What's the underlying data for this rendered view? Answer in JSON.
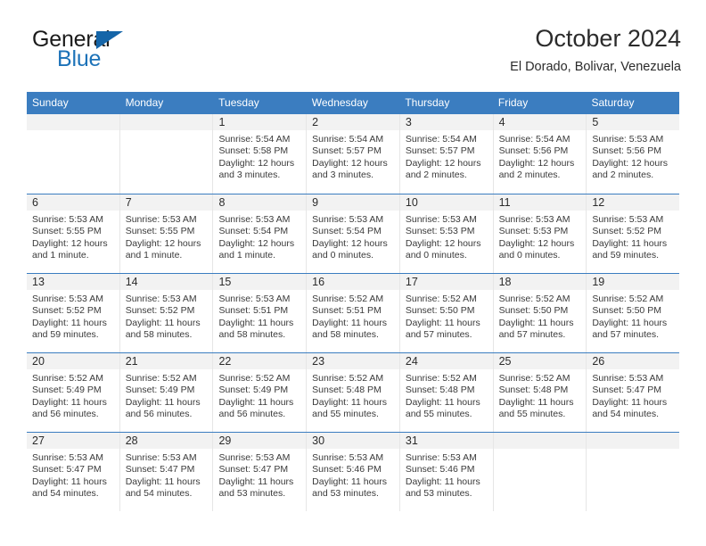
{
  "logo": {
    "word_top": "General",
    "word_bottom": "Blue",
    "accent_color": "#1c72b8"
  },
  "header": {
    "title": "October 2024",
    "subtitle": "El Dorado, Bolivar, Venezuela"
  },
  "theme": {
    "header_blue": "#3b7dc0",
    "day_band_gray": "#f2f2f2",
    "cell_border": "#e6e6e6"
  },
  "weekdays": [
    "Sunday",
    "Monday",
    "Tuesday",
    "Wednesday",
    "Thursday",
    "Friday",
    "Saturday"
  ],
  "weeks": [
    [
      {
        "day": "",
        "sunrise": "",
        "sunset": "",
        "daylight_a": "",
        "daylight_b": ""
      },
      {
        "day": "",
        "sunrise": "",
        "sunset": "",
        "daylight_a": "",
        "daylight_b": ""
      },
      {
        "day": "1",
        "sunrise": "Sunrise: 5:54 AM",
        "sunset": "Sunset: 5:58 PM",
        "daylight_a": "Daylight: 12 hours",
        "daylight_b": "and 3 minutes."
      },
      {
        "day": "2",
        "sunrise": "Sunrise: 5:54 AM",
        "sunset": "Sunset: 5:57 PM",
        "daylight_a": "Daylight: 12 hours",
        "daylight_b": "and 3 minutes."
      },
      {
        "day": "3",
        "sunrise": "Sunrise: 5:54 AM",
        "sunset": "Sunset: 5:57 PM",
        "daylight_a": "Daylight: 12 hours",
        "daylight_b": "and 2 minutes."
      },
      {
        "day": "4",
        "sunrise": "Sunrise: 5:54 AM",
        "sunset": "Sunset: 5:56 PM",
        "daylight_a": "Daylight: 12 hours",
        "daylight_b": "and 2 minutes."
      },
      {
        "day": "5",
        "sunrise": "Sunrise: 5:53 AM",
        "sunset": "Sunset: 5:56 PM",
        "daylight_a": "Daylight: 12 hours",
        "daylight_b": "and 2 minutes."
      }
    ],
    [
      {
        "day": "6",
        "sunrise": "Sunrise: 5:53 AM",
        "sunset": "Sunset: 5:55 PM",
        "daylight_a": "Daylight: 12 hours",
        "daylight_b": "and 1 minute."
      },
      {
        "day": "7",
        "sunrise": "Sunrise: 5:53 AM",
        "sunset": "Sunset: 5:55 PM",
        "daylight_a": "Daylight: 12 hours",
        "daylight_b": "and 1 minute."
      },
      {
        "day": "8",
        "sunrise": "Sunrise: 5:53 AM",
        "sunset": "Sunset: 5:54 PM",
        "daylight_a": "Daylight: 12 hours",
        "daylight_b": "and 1 minute."
      },
      {
        "day": "9",
        "sunrise": "Sunrise: 5:53 AM",
        "sunset": "Sunset: 5:54 PM",
        "daylight_a": "Daylight: 12 hours",
        "daylight_b": "and 0 minutes."
      },
      {
        "day": "10",
        "sunrise": "Sunrise: 5:53 AM",
        "sunset": "Sunset: 5:53 PM",
        "daylight_a": "Daylight: 12 hours",
        "daylight_b": "and 0 minutes."
      },
      {
        "day": "11",
        "sunrise": "Sunrise: 5:53 AM",
        "sunset": "Sunset: 5:53 PM",
        "daylight_a": "Daylight: 12 hours",
        "daylight_b": "and 0 minutes."
      },
      {
        "day": "12",
        "sunrise": "Sunrise: 5:53 AM",
        "sunset": "Sunset: 5:52 PM",
        "daylight_a": "Daylight: 11 hours",
        "daylight_b": "and 59 minutes."
      }
    ],
    [
      {
        "day": "13",
        "sunrise": "Sunrise: 5:53 AM",
        "sunset": "Sunset: 5:52 PM",
        "daylight_a": "Daylight: 11 hours",
        "daylight_b": "and 59 minutes."
      },
      {
        "day": "14",
        "sunrise": "Sunrise: 5:53 AM",
        "sunset": "Sunset: 5:52 PM",
        "daylight_a": "Daylight: 11 hours",
        "daylight_b": "and 58 minutes."
      },
      {
        "day": "15",
        "sunrise": "Sunrise: 5:53 AM",
        "sunset": "Sunset: 5:51 PM",
        "daylight_a": "Daylight: 11 hours",
        "daylight_b": "and 58 minutes."
      },
      {
        "day": "16",
        "sunrise": "Sunrise: 5:52 AM",
        "sunset": "Sunset: 5:51 PM",
        "daylight_a": "Daylight: 11 hours",
        "daylight_b": "and 58 minutes."
      },
      {
        "day": "17",
        "sunrise": "Sunrise: 5:52 AM",
        "sunset": "Sunset: 5:50 PM",
        "daylight_a": "Daylight: 11 hours",
        "daylight_b": "and 57 minutes."
      },
      {
        "day": "18",
        "sunrise": "Sunrise: 5:52 AM",
        "sunset": "Sunset: 5:50 PM",
        "daylight_a": "Daylight: 11 hours",
        "daylight_b": "and 57 minutes."
      },
      {
        "day": "19",
        "sunrise": "Sunrise: 5:52 AM",
        "sunset": "Sunset: 5:50 PM",
        "daylight_a": "Daylight: 11 hours",
        "daylight_b": "and 57 minutes."
      }
    ],
    [
      {
        "day": "20",
        "sunrise": "Sunrise: 5:52 AM",
        "sunset": "Sunset: 5:49 PM",
        "daylight_a": "Daylight: 11 hours",
        "daylight_b": "and 56 minutes."
      },
      {
        "day": "21",
        "sunrise": "Sunrise: 5:52 AM",
        "sunset": "Sunset: 5:49 PM",
        "daylight_a": "Daylight: 11 hours",
        "daylight_b": "and 56 minutes."
      },
      {
        "day": "22",
        "sunrise": "Sunrise: 5:52 AM",
        "sunset": "Sunset: 5:49 PM",
        "daylight_a": "Daylight: 11 hours",
        "daylight_b": "and 56 minutes."
      },
      {
        "day": "23",
        "sunrise": "Sunrise: 5:52 AM",
        "sunset": "Sunset: 5:48 PM",
        "daylight_a": "Daylight: 11 hours",
        "daylight_b": "and 55 minutes."
      },
      {
        "day": "24",
        "sunrise": "Sunrise: 5:52 AM",
        "sunset": "Sunset: 5:48 PM",
        "daylight_a": "Daylight: 11 hours",
        "daylight_b": "and 55 minutes."
      },
      {
        "day": "25",
        "sunrise": "Sunrise: 5:52 AM",
        "sunset": "Sunset: 5:48 PM",
        "daylight_a": "Daylight: 11 hours",
        "daylight_b": "and 55 minutes."
      },
      {
        "day": "26",
        "sunrise": "Sunrise: 5:53 AM",
        "sunset": "Sunset: 5:47 PM",
        "daylight_a": "Daylight: 11 hours",
        "daylight_b": "and 54 minutes."
      }
    ],
    [
      {
        "day": "27",
        "sunrise": "Sunrise: 5:53 AM",
        "sunset": "Sunset: 5:47 PM",
        "daylight_a": "Daylight: 11 hours",
        "daylight_b": "and 54 minutes."
      },
      {
        "day": "28",
        "sunrise": "Sunrise: 5:53 AM",
        "sunset": "Sunset: 5:47 PM",
        "daylight_a": "Daylight: 11 hours",
        "daylight_b": "and 54 minutes."
      },
      {
        "day": "29",
        "sunrise": "Sunrise: 5:53 AM",
        "sunset": "Sunset: 5:47 PM",
        "daylight_a": "Daylight: 11 hours",
        "daylight_b": "and 53 minutes."
      },
      {
        "day": "30",
        "sunrise": "Sunrise: 5:53 AM",
        "sunset": "Sunset: 5:46 PM",
        "daylight_a": "Daylight: 11 hours",
        "daylight_b": "and 53 minutes."
      },
      {
        "day": "31",
        "sunrise": "Sunrise: 5:53 AM",
        "sunset": "Sunset: 5:46 PM",
        "daylight_a": "Daylight: 11 hours",
        "daylight_b": "and 53 minutes."
      },
      {
        "day": "",
        "sunrise": "",
        "sunset": "",
        "daylight_a": "",
        "daylight_b": ""
      },
      {
        "day": "",
        "sunrise": "",
        "sunset": "",
        "daylight_a": "",
        "daylight_b": ""
      }
    ]
  ]
}
